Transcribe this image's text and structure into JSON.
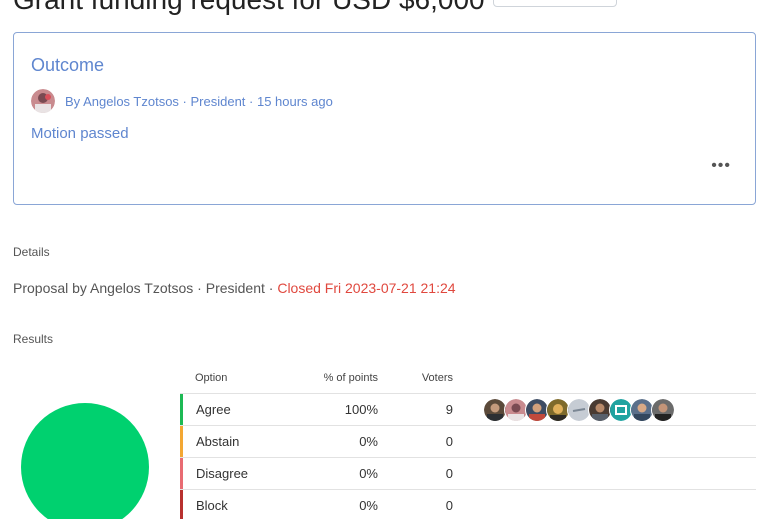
{
  "header": {
    "title": "Grant funding request for USD $6,000"
  },
  "outcome": {
    "heading": "Outcome",
    "meta": "By Angelos Tzotsos · President · 15 hours ago",
    "statement": "Motion passed",
    "more_label": "•••"
  },
  "details": {
    "label": "Details",
    "proposal_text": "Proposal by Angelos Tzotsos · President · ",
    "closed_text": "Closed Fri 2023-07-21 21:24"
  },
  "results": {
    "label": "Results",
    "columns": {
      "option": "Option",
      "points": "% of points",
      "voters": "Voters"
    },
    "rows": [
      {
        "option": "Agree",
        "percent": "100%",
        "voters": "9",
        "color": "#1db954"
      },
      {
        "option": "Abstain",
        "percent": "0%",
        "voters": "0",
        "color": "#f3a733"
      },
      {
        "option": "Disagree",
        "percent": "0%",
        "voters": "0",
        "color": "#e86b72"
      },
      {
        "option": "Block",
        "percent": "0%",
        "voters": "0",
        "color": "#b8312f"
      }
    ]
  },
  "chart_data": {
    "type": "pie",
    "categories": [
      "Agree",
      "Abstain",
      "Disagree",
      "Block"
    ],
    "values": [
      100,
      0,
      0,
      0
    ],
    "colors": [
      "#00d16f",
      "#f3a733",
      "#e86b72",
      "#b8312f"
    ]
  }
}
